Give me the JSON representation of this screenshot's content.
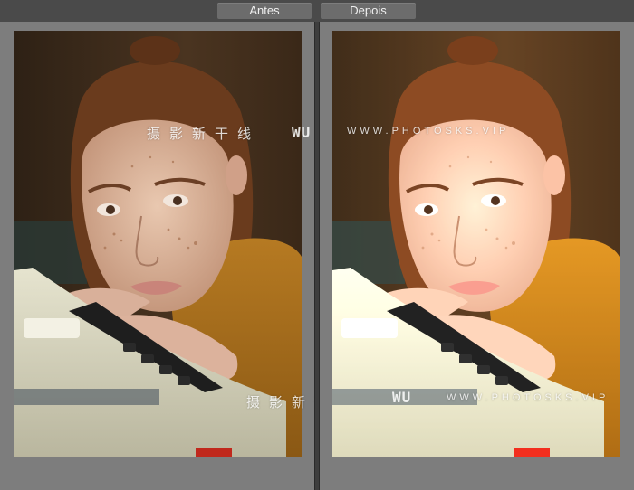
{
  "compare": {
    "before_label": "Antes",
    "after_label": "Depois"
  },
  "watermark": {
    "cn_text": "摄影新干线",
    "logo_text": "WU",
    "url_text": "WWW.PHOTOSKS.VIP"
  },
  "colors": {
    "background": "#7d7d7d",
    "topbar": "#4a4a4a",
    "tab": "#6c6c6c",
    "divider": "#3e3e3e"
  }
}
